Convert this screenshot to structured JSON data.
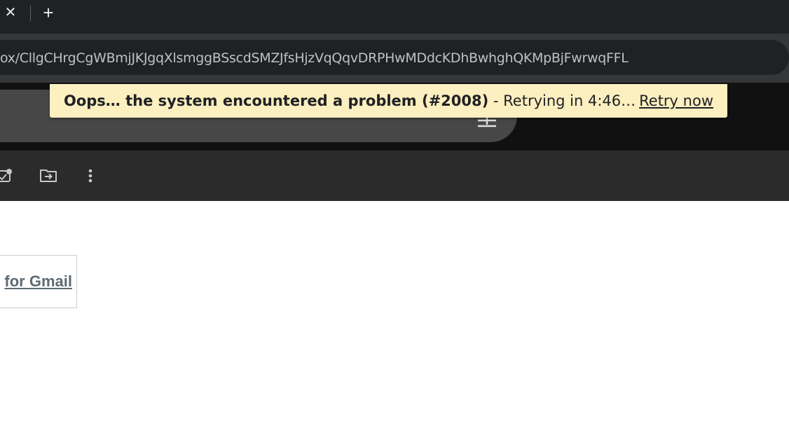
{
  "browser": {
    "tab_close_glyph": "✕",
    "new_tab_glyph": "+",
    "url": "ox/CllgCHrgCgWBmjJKJgqXlsmggBSscdSMZJfsHjzVqQqvDRPHwMDdcKDhBwhghQKMpBjFwrwqFFL"
  },
  "notice": {
    "bold_text": "Oops… the system encountered a problem (#2008)",
    "rest_text": " - Retrying in 4:46…",
    "retry_label": "Retry now",
    "background": "#fcefc0"
  },
  "toolbar": {
    "icons": [
      "mark-done-icon",
      "move-to-icon",
      "more-vert-icon"
    ]
  },
  "content": {
    "link_text": "for Gmail",
    "link_color": "#5f6b73"
  },
  "colors": {
    "tabstrip": "#202124",
    "browser_toolbar": "#35363a",
    "appbar": "#111111",
    "searchbar": "#474747",
    "gmail_toolbar": "#2b2b2b"
  }
}
